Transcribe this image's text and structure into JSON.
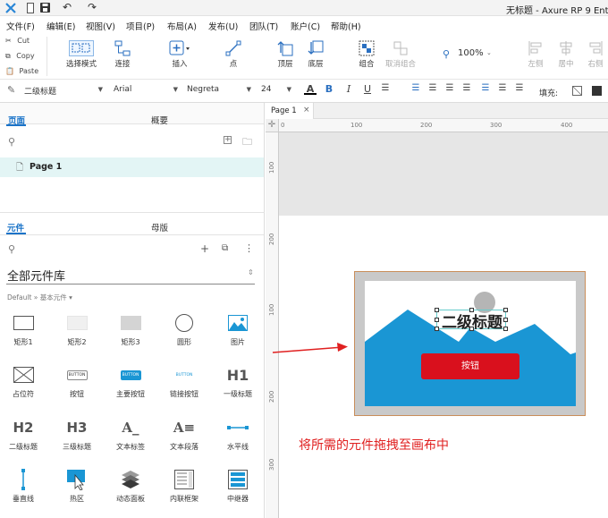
{
  "titlebar": {
    "title": "无标题 - Axure RP 9 Ente",
    "logo": "axure-logo-icon"
  },
  "menu": [
    "文件(F)",
    "编辑(E)",
    "视图(V)",
    "项目(P)",
    "布局(A)",
    "发布(U)",
    "团队(T)",
    "账户(C)",
    "帮助(H)"
  ],
  "clipboard": {
    "cut": "Cut",
    "copy": "Copy",
    "paste": "Paste"
  },
  "toolbar": {
    "select_mode": "选择模式",
    "connect": "连接",
    "insert": "插入",
    "point": "点",
    "top_layer": "顶层",
    "bottom_layer": "底层",
    "group": "组合",
    "ungroup": "取消组合",
    "zoom": "100%",
    "align_left": "左侧",
    "align_center": "居中",
    "align_right": "右侧"
  },
  "format": {
    "style": "二级标题",
    "font": "Arial",
    "weight": "Negreta",
    "size": "24",
    "fill_label": "填充:"
  },
  "pages_panel": {
    "tab_pages": "页面",
    "tab_outline": "概要",
    "page_item": "Page 1"
  },
  "widgets_panel": {
    "tab_widgets": "元件",
    "tab_masters": "母版",
    "library_title": "全部元件库",
    "library_sub": "Default » 基本元件 ▾",
    "items": [
      {
        "label": "矩形1"
      },
      {
        "label": "矩形2"
      },
      {
        "label": "矩形3"
      },
      {
        "label": "圆形"
      },
      {
        "label": "图片"
      },
      {
        "label": "占位符"
      },
      {
        "label": "按钮"
      },
      {
        "label": "主要按钮"
      },
      {
        "label": "链接按钮"
      },
      {
        "label": "一级标题"
      },
      {
        "label": "二级标题"
      },
      {
        "label": "三级标题"
      },
      {
        "label": "文本标签"
      },
      {
        "label": "文本段落"
      },
      {
        "label": "水平线"
      },
      {
        "label": "垂直线"
      },
      {
        "label": "热区"
      },
      {
        "label": "动态面板"
      },
      {
        "label": "内联框架"
      },
      {
        "label": "中继器"
      }
    ],
    "button_icon_texts": {
      "button": "BUTTON",
      "primary": "BUTTON",
      "link": "BUTTON"
    },
    "heading_icon_texts": {
      "h1": "H1",
      "h2": "H2",
      "h3": "H3"
    }
  },
  "canvas": {
    "tab": "Page 1",
    "ruler_h": [
      "0",
      "100",
      "200",
      "300",
      "400"
    ],
    "ruler_v": [
      "100",
      "200",
      "100",
      "200",
      "300"
    ],
    "heading_text": "二级标题",
    "button_text": "按钮",
    "annotation": "将所需的元件拖拽至画布中"
  },
  "colors": {
    "accent_red": "#e02020",
    "mountain_blue": "#1a96d4",
    "button_red": "#d9101d",
    "panel_tab_active": "#1a73c8",
    "selected_row": "#e3f5f5"
  }
}
